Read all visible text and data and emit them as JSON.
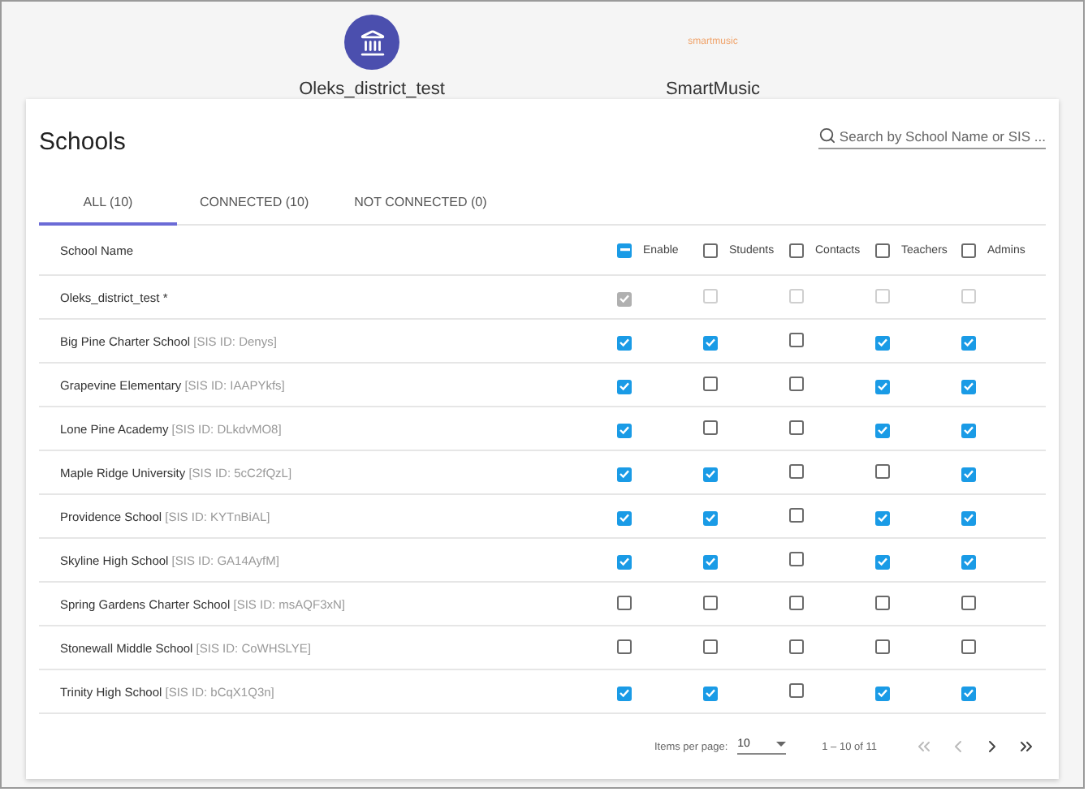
{
  "accounts": [
    {
      "kind": "district",
      "name": "Oleks_district_test"
    },
    {
      "kind": "app",
      "logo": "smartmusic",
      "name": "SmartMusic"
    }
  ],
  "card": {
    "title": "Schools",
    "search": {
      "placeholder": "Search by School Name or SIS ..."
    },
    "tabs": [
      {
        "label": "ALL (10)",
        "selected": true
      },
      {
        "label": "CONNECTED (10)",
        "selected": false
      },
      {
        "label": "NOT CONNECTED (0)",
        "selected": false
      }
    ],
    "table": {
      "name_header": "School Name",
      "columns": [
        {
          "label": "Enable",
          "indeterminate": true
        },
        {
          "label": "Students",
          "indeterminate": false
        },
        {
          "label": "Contacts",
          "indeterminate": false
        },
        {
          "label": "Teachers",
          "indeterminate": false
        },
        {
          "label": "Admins",
          "indeterminate": false
        }
      ],
      "rows": [
        {
          "name": "Oleks_district_test *",
          "sis": "",
          "disabled": true,
          "checks": [
            true,
            false,
            false,
            false,
            false
          ]
        },
        {
          "name": "Big Pine Charter School",
          "sis": "[SIS ID: Denys]",
          "disabled": false,
          "checks": [
            true,
            true,
            false,
            true,
            true
          ]
        },
        {
          "name": "Grapevine Elementary",
          "sis": "[SIS ID: IAAPYkfs]",
          "disabled": false,
          "checks": [
            true,
            false,
            false,
            true,
            true
          ]
        },
        {
          "name": "Lone Pine Academy",
          "sis": "[SIS ID: DLkdvMO8]",
          "disabled": false,
          "checks": [
            true,
            false,
            false,
            true,
            true
          ]
        },
        {
          "name": "Maple Ridge University",
          "sis": "[SIS ID: 5cC2fQzL]",
          "disabled": false,
          "checks": [
            true,
            true,
            false,
            false,
            true
          ]
        },
        {
          "name": "Providence School",
          "sis": "[SIS ID: KYTnBiAL]",
          "disabled": false,
          "checks": [
            true,
            true,
            false,
            true,
            true
          ]
        },
        {
          "name": "Skyline High School",
          "sis": "[SIS ID: GA14AyfM]",
          "disabled": false,
          "checks": [
            true,
            true,
            false,
            true,
            true
          ]
        },
        {
          "name": "Spring Gardens Charter School",
          "sis": "[SIS ID: msAQF3xN]",
          "disabled": false,
          "checks": [
            false,
            false,
            false,
            false,
            false
          ]
        },
        {
          "name": "Stonewall Middle School",
          "sis": "[SIS ID: CoWHSLYE]",
          "disabled": false,
          "checks": [
            false,
            false,
            false,
            false,
            false
          ]
        },
        {
          "name": "Trinity High School",
          "sis": "[SIS ID: bCqX1Q3n]",
          "disabled": false,
          "checks": [
            true,
            true,
            false,
            true,
            true
          ]
        }
      ]
    },
    "paginator": {
      "label": "Items per page:",
      "page_size": "10",
      "range": "1 – 10 of 11",
      "buttons": [
        {
          "kind": "first",
          "disabled": true
        },
        {
          "kind": "prev",
          "disabled": true
        },
        {
          "kind": "next",
          "disabled": false
        },
        {
          "kind": "last",
          "disabled": false
        }
      ]
    }
  }
}
